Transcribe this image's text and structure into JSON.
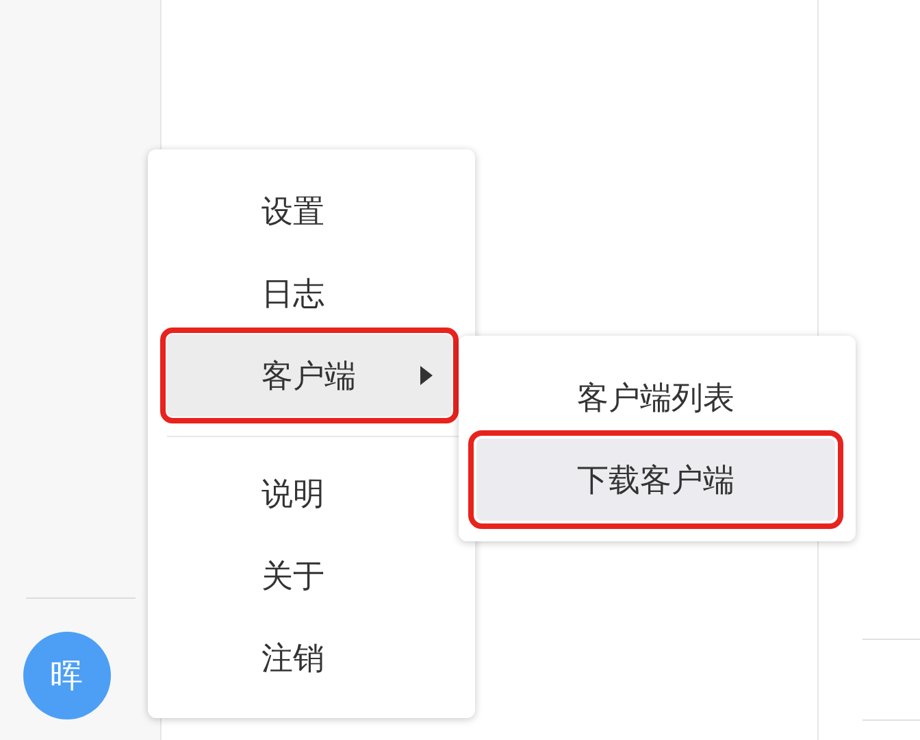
{
  "sidebar": {
    "avatar": "晖"
  },
  "menu": {
    "items": [
      {
        "kind": "item",
        "label": "设置",
        "highlighted": false,
        "annotated": false
      },
      {
        "kind": "item",
        "label": "日志",
        "highlighted": false,
        "annotated": false
      },
      {
        "kind": "submenu",
        "label": "客户端",
        "highlighted": true,
        "annotated": true
      },
      {
        "kind": "separator"
      },
      {
        "kind": "item",
        "label": "说明",
        "highlighted": false,
        "annotated": false
      },
      {
        "kind": "item",
        "label": "关于",
        "highlighted": false,
        "annotated": false
      },
      {
        "kind": "item",
        "label": "注销",
        "highlighted": false,
        "annotated": false
      }
    ]
  },
  "submenu": {
    "items": [
      {
        "label": "客户端列表",
        "highlighted": false,
        "annotated": false
      },
      {
        "label": "下载客户端",
        "highlighted": true,
        "annotated": true
      }
    ]
  }
}
